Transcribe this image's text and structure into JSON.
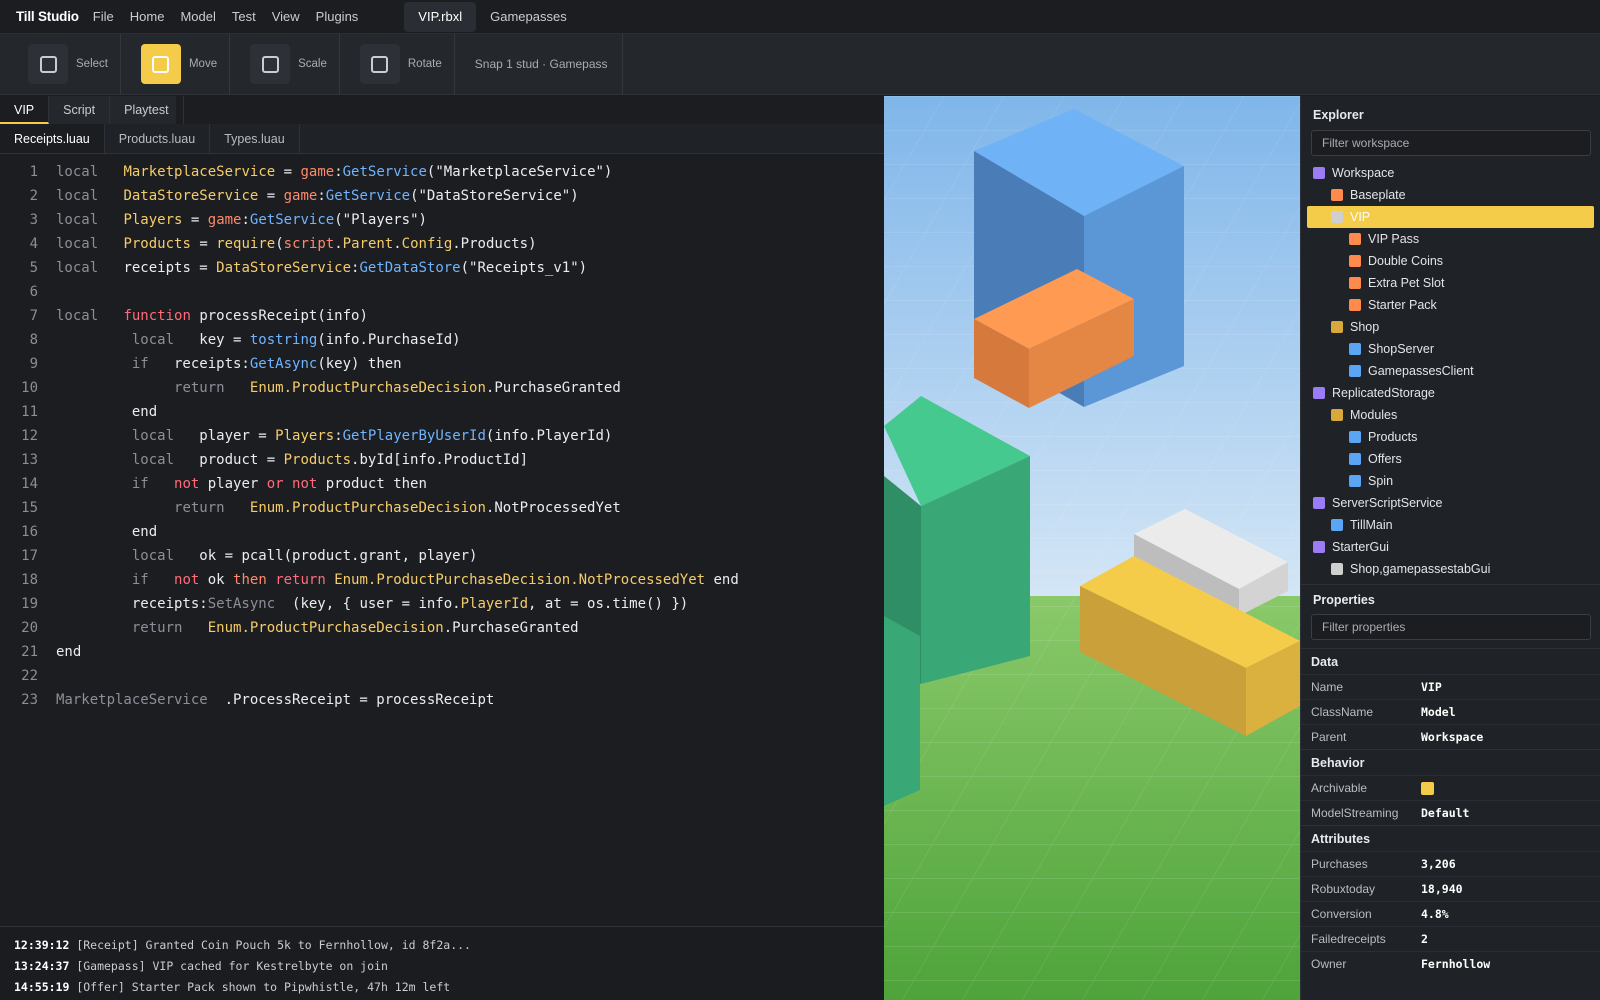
{
  "app": {
    "title": "Till Studio",
    "menu": [
      "File",
      "Home",
      "Model",
      "Test",
      "View",
      "Plugins"
    ],
    "doc_tabs": [
      "VIP.rbxl",
      "Gamepasses"
    ]
  },
  "toolbar": {
    "tools": [
      {
        "label": "Select",
        "active": false
      },
      {
        "label": "Move",
        "active": true
      },
      {
        "label": "Scale",
        "active": false
      },
      {
        "label": "Rotate",
        "active": false
      }
    ],
    "snap": "Snap 1 stud · Gamepass"
  },
  "view_tabs": [
    "VIP",
    "Script",
    "Playtest"
  ],
  "file_tabs": [
    "Receipts.luau",
    "Products.luau",
    "Types.luau"
  ],
  "code": [
    [
      {
        "t": "local",
        "c": "kw"
      },
      {
        "t": "   "
      },
      {
        "t": "MarketplaceService",
        "c": "var"
      },
      {
        "t": " = "
      },
      {
        "t": "game",
        "c": "game"
      },
      {
        "t": ":"
      },
      {
        "t": "GetService",
        "c": "method"
      },
      {
        "t": "(\"MarketplaceService\")"
      }
    ],
    [
      {
        "t": "local",
        "c": "kw"
      },
      {
        "t": "   "
      },
      {
        "t": "DataStoreService",
        "c": "var"
      },
      {
        "t": " = "
      },
      {
        "t": "game",
        "c": "game"
      },
      {
        "t": ":"
      },
      {
        "t": "GetService",
        "c": "method"
      },
      {
        "t": "(\"DataStoreService\")"
      }
    ],
    [
      {
        "t": "local",
        "c": "kw"
      },
      {
        "t": "   "
      },
      {
        "t": "Players",
        "c": "var"
      },
      {
        "t": " = "
      },
      {
        "t": "game",
        "c": "game"
      },
      {
        "t": ":"
      },
      {
        "t": "GetService",
        "c": "method"
      },
      {
        "t": "(\"Players\")"
      }
    ],
    [
      {
        "t": "local",
        "c": "kw"
      },
      {
        "t": "   "
      },
      {
        "t": "Products",
        "c": "var"
      },
      {
        "t": " = "
      },
      {
        "t": "require",
        "c": "var"
      },
      {
        "t": "("
      },
      {
        "t": "script",
        "c": "game"
      },
      {
        "t": "."
      },
      {
        "t": "Parent",
        "c": "var"
      },
      {
        "t": "."
      },
      {
        "t": "Config",
        "c": "var"
      },
      {
        "t": ".Products)"
      }
    ],
    [
      {
        "t": "local",
        "c": "kw"
      },
      {
        "t": "   "
      },
      {
        "t": "receipts = "
      },
      {
        "t": "DataStoreService",
        "c": "var"
      },
      {
        "t": ":"
      },
      {
        "t": "GetDataStore",
        "c": "method"
      },
      {
        "t": "(\"Receipts_v1\")"
      }
    ],
    [],
    [
      {
        "t": "local",
        "c": "kw"
      },
      {
        "t": "   "
      },
      {
        "t": "function",
        "c": "fn"
      },
      {
        "t": " processReceipt(info)"
      }
    ],
    [
      {
        "t": "         "
      },
      {
        "t": "local",
        "c": "kw"
      },
      {
        "t": "   key = "
      },
      {
        "t": "tostring",
        "c": "method"
      },
      {
        "t": "(info.PurchaseId)"
      }
    ],
    [
      {
        "t": "         "
      },
      {
        "t": "if",
        "c": "kw"
      },
      {
        "t": "   receipts:"
      },
      {
        "t": "GetAsync",
        "c": "method"
      },
      {
        "t": "(key) then"
      }
    ],
    [
      {
        "t": "              "
      },
      {
        "t": "return",
        "c": "kw"
      },
      {
        "t": "   "
      },
      {
        "t": "Enum.ProductPurchaseDecision",
        "c": "var"
      },
      {
        "t": ".PurchaseGranted"
      }
    ],
    [
      {
        "t": "         end"
      }
    ],
    [
      {
        "t": "         "
      },
      {
        "t": "local",
        "c": "kw"
      },
      {
        "t": "   player = "
      },
      {
        "t": "Players",
        "c": "var"
      },
      {
        "t": ":"
      },
      {
        "t": "GetPlayerByUserId",
        "c": "method"
      },
      {
        "t": "(info.PlayerId)"
      }
    ],
    [
      {
        "t": "         "
      },
      {
        "t": "local",
        "c": "kw"
      },
      {
        "t": "   product = "
      },
      {
        "t": "Products",
        "c": "var"
      },
      {
        "t": ".byId[info.ProductId]"
      }
    ],
    [
      {
        "t": "         "
      },
      {
        "t": "if",
        "c": "kw"
      },
      {
        "t": "   "
      },
      {
        "t": "not",
        "c": "fn"
      },
      {
        "t": " player "
      },
      {
        "t": "or",
        "c": "fn"
      },
      {
        "t": " "
      },
      {
        "t": "not",
        "c": "fn"
      },
      {
        "t": " product then"
      }
    ],
    [
      {
        "t": "              "
      },
      {
        "t": "return",
        "c": "kw"
      },
      {
        "t": "   "
      },
      {
        "t": "Enum.ProductPurchaseDecision",
        "c": "var"
      },
      {
        "t": ".NotProcessedYet"
      }
    ],
    [
      {
        "t": "         end"
      }
    ],
    [
      {
        "t": "         "
      },
      {
        "t": "local",
        "c": "kw"
      },
      {
        "t": "   ok = pcall(product.grant, player)"
      }
    ],
    [
      {
        "t": "         "
      },
      {
        "t": "if",
        "c": "kw"
      },
      {
        "t": "   "
      },
      {
        "t": "not",
        "c": "fn"
      },
      {
        "t": " ok "
      },
      {
        "t": "then",
        "c": "game"
      },
      {
        "t": " "
      },
      {
        "t": "return",
        "c": "fn"
      },
      {
        "t": " "
      },
      {
        "t": "Enum.ProductPurchaseDecision.NotProcessedYet",
        "c": "var"
      },
      {
        "t": " end"
      }
    ],
    [
      {
        "t": "         receipts:"
      },
      {
        "t": "SetAsync",
        "c": "kw"
      },
      {
        "t": "  (key, { user = info."
      },
      {
        "t": "PlayerId",
        "c": "var"
      },
      {
        "t": ", at = os.time() })"
      }
    ],
    [
      {
        "t": "         "
      },
      {
        "t": "return",
        "c": "kw"
      },
      {
        "t": "   "
      },
      {
        "t": "Enum.ProductPurchaseDecision",
        "c": "var"
      },
      {
        "t": ".PurchaseGranted"
      }
    ],
    [
      {
        "t": "end"
      }
    ],
    [],
    [
      {
        "t": "MarketplaceService",
        "c": "kw"
      },
      {
        "t": "  .ProcessReceipt = processReceipt"
      }
    ]
  ],
  "console": [
    {
      "ts": "12:39:12",
      "msg": " [Receipt] Granted Coin Pouch 5k to Fernhollow, id 8f2a..."
    },
    {
      "ts": "13:24:37",
      "msg": " [Gamepass] VIP cached for Kestrelbyte on join"
    },
    {
      "ts": "14:55:19",
      "msg": " [Offer] Starter Pack shown to Pipwhistle, 47h 12m left"
    }
  ],
  "explorer": {
    "title": "Explorer",
    "filter_placeholder": "Filter workspace",
    "items": [
      {
        "label": "Workspace",
        "depth": 0,
        "color": "#9b7cf5",
        "selected": false
      },
      {
        "label": "Baseplate",
        "depth": 1,
        "color": "#ff8a4c",
        "selected": false
      },
      {
        "label": "VIP",
        "depth": 1,
        "color": "#cfcfcf",
        "selected": true
      },
      {
        "label": "VIP Pass",
        "depth": 2,
        "color": "#ff8a4c",
        "selected": false
      },
      {
        "label": "Double Coins",
        "depth": 2,
        "color": "#ff8a4c",
        "selected": false
      },
      {
        "label": "Extra Pet Slot",
        "depth": 2,
        "color": "#ff8a4c",
        "selected": false
      },
      {
        "label": "Starter Pack",
        "depth": 2,
        "color": "#ff8a4c",
        "selected": false
      },
      {
        "label": "Shop",
        "depth": 1,
        "color": "#d8a83a",
        "selected": false
      },
      {
        "label": "ShopServer",
        "depth": 2,
        "color": "#5aa6f5",
        "selected": false
      },
      {
        "label": "GamepassesClient",
        "depth": 2,
        "color": "#5aa6f5",
        "selected": false
      },
      {
        "label": "ReplicatedStorage",
        "depth": 0,
        "color": "#9b7cf5",
        "selected": false
      },
      {
        "label": "Modules",
        "depth": 1,
        "color": "#d8a83a",
        "selected": false
      },
      {
        "label": "Products",
        "depth": 2,
        "color": "#5aa6f5",
        "selected": false
      },
      {
        "label": "Offers",
        "depth": 2,
        "color": "#5aa6f5",
        "selected": false
      },
      {
        "label": "Spin",
        "depth": 2,
        "color": "#5aa6f5",
        "selected": false
      },
      {
        "label": "ServerScriptService",
        "depth": 0,
        "color": "#9b7cf5",
        "selected": false
      },
      {
        "label": "TillMain",
        "depth": 1,
        "color": "#5aa6f5",
        "selected": false
      },
      {
        "label": "StarterGui",
        "depth": 0,
        "color": "#9b7cf5",
        "selected": false
      },
      {
        "label": "Shop,gamepassestabGui",
        "depth": 1,
        "color": "#cfcfcf",
        "selected": false
      }
    ]
  },
  "properties": {
    "title": "Properties",
    "filter_placeholder": "Filter properties",
    "sections": [
      {
        "name": "Data",
        "rows": [
          {
            "key": "Name",
            "value": "VIP"
          },
          {
            "key": "ClassName",
            "value": "Model"
          },
          {
            "key": "Parent",
            "value": "Workspace"
          }
        ]
      },
      {
        "name": "Behavior",
        "rows": [
          {
            "key": "Archivable",
            "value": "",
            "swatch": true
          },
          {
            "key": "ModelStreaming",
            "value": "Default"
          }
        ]
      },
      {
        "name": "Attributes",
        "rows": [
          {
            "key": "Purchases",
            "value": "3,206"
          },
          {
            "key": "Robuxtoday",
            "value": "18,940"
          },
          {
            "key": "Conversion",
            "value": "4.8%"
          },
          {
            "key": "Failedreceipts",
            "value": "2"
          },
          {
            "key": "Owner",
            "value": "Fernhollow"
          }
        ]
      }
    ]
  },
  "colors": {
    "accent": "#f5cc4a",
    "background": "#1b1d21",
    "panel": "#1f2226"
  }
}
